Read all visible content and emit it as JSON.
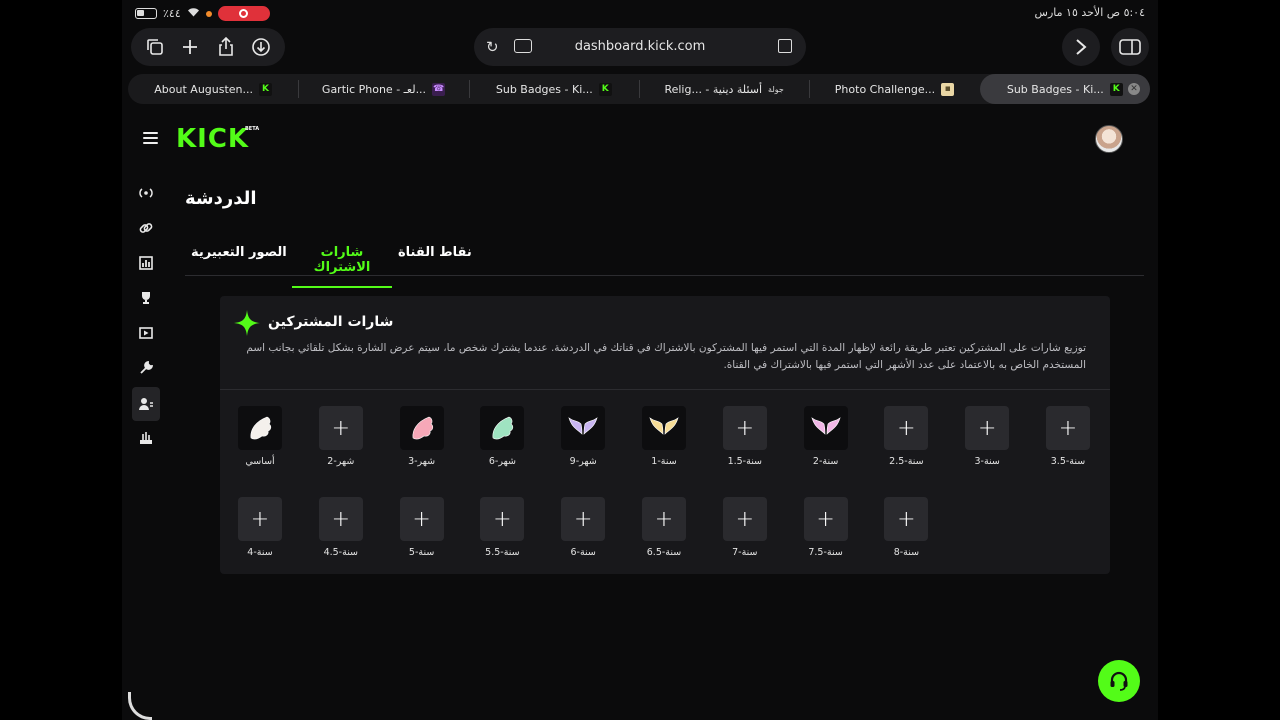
{
  "status_bar": {
    "battery": "٪٤٤",
    "datetime": "٥:٠٤ ص  الأحد ١٥ مارس"
  },
  "browser": {
    "url": "dashboard.kick.com",
    "tabs": [
      {
        "label": "About Augusten...",
        "favicon": "kick-icon"
      },
      {
        "label": "Gartic Phone - لعـ...",
        "favicon": "phone-icon"
      },
      {
        "label": "Sub Badges - Ki...",
        "favicon": "kick-icon"
      },
      {
        "label": "Relig... - أسئلة دينية",
        "favicon": "jolah-icon",
        "favicon_text": "جولة"
      },
      {
        "label": "Photo Challenge...",
        "favicon": "photo-icon"
      },
      {
        "label": "Sub Badges - Ki...",
        "favicon": "kick-icon",
        "active": true
      }
    ]
  },
  "app": {
    "logo": "KICK",
    "logo_badge": "BETA",
    "accent": "#53fc18"
  },
  "page": {
    "title": "الدردشة",
    "tabs": [
      "نقاط القناة",
      "شارات الاشتراك",
      "الصور التعبيرية"
    ],
    "active_tab": 1
  },
  "card": {
    "title": "شارات المشتركين",
    "description": "توزيع شارات على المشتركين تعتبر طريقة رائعة لإظهار المدة التي استمر فيها المشتركون بالاشتراك في قناتك في الدردشة. عندما يشترك شخص ما، سيتم عرض الشارة بشكل تلقائي بجانب اسم المستخدم الخاص به بالاعتماد على عدد الأشهر التي استمر فيها بالاشتراك في القناة."
  },
  "badges": [
    {
      "label": "أساسي",
      "image": "white-wings",
      "color": "#f4f0ec"
    },
    {
      "label": "شهر-2",
      "image": "add"
    },
    {
      "label": "شهر-3",
      "image": "pink-wings",
      "color": "#f6a8b8"
    },
    {
      "label": "شهر-6",
      "image": "mint-wings",
      "color": "#9fe3c1"
    },
    {
      "label": "شهر-9",
      "image": "lavender-wings",
      "color": "#c9b5f2"
    },
    {
      "label": "سنة-1",
      "image": "gold-wings",
      "color": "#f6dc96"
    },
    {
      "label": "سنة-1.5",
      "image": "add"
    },
    {
      "label": "سنة-2",
      "image": "rainbow-wings",
      "color": "#f1b6e6"
    },
    {
      "label": "سنة-2.5",
      "image": "add"
    },
    {
      "label": "سنة-3",
      "image": "add"
    },
    {
      "label": "سنة-3.5",
      "image": "add"
    },
    {
      "label": "سنة-4",
      "image": "add"
    },
    {
      "label": "سنة-4.5",
      "image": "add"
    },
    {
      "label": "سنة-5",
      "image": "add"
    },
    {
      "label": "سنة-5.5",
      "image": "add"
    },
    {
      "label": "سنة-6",
      "image": "add"
    },
    {
      "label": "سنة-6.5",
      "image": "add"
    },
    {
      "label": "سنة-7",
      "image": "add"
    },
    {
      "label": "سنة-7.5",
      "image": "add"
    },
    {
      "label": "سنة-8",
      "image": "add"
    }
  ],
  "add_symbol": "+"
}
